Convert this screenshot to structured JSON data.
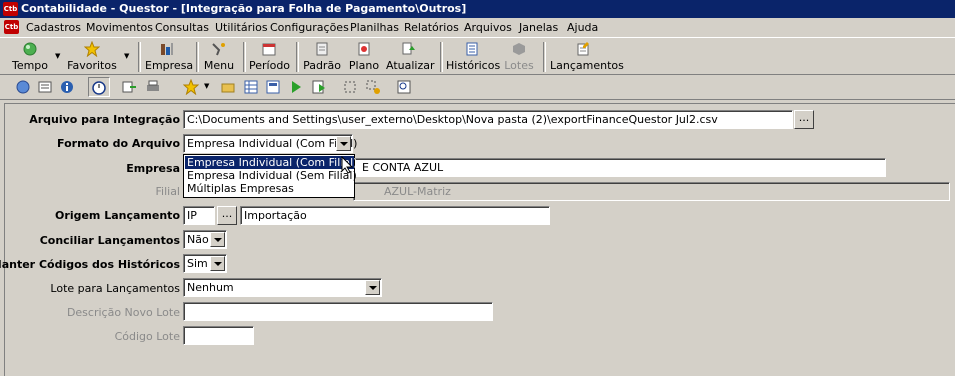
{
  "window": {
    "app_icon": "Ctb",
    "title": "Contabilidade - Questor - [Integração para Folha de Pagamento\\Outros]"
  },
  "menubar": {
    "items": [
      "Cadastros",
      "Movimentos",
      "Consultas",
      "Utilitários",
      "Configurações",
      "Planilhas",
      "Relatórios",
      "Arquivos",
      "Janelas",
      "Ajuda"
    ]
  },
  "toolbar": {
    "tempo": "Tempo",
    "favoritos": "Favoritos",
    "empresa": "Empresa",
    "menu": "Menu",
    "periodo": "Período",
    "padrao": "Padrão",
    "plano": "Plano",
    "atualizar": "Atualizar",
    "historicos": "Históricos",
    "lotes": "Lotes",
    "lancamentos": "Lançamentos"
  },
  "form": {
    "arquivo_label": "Arquivo para Integração",
    "arquivo_value": "C:\\Documents and Settings\\user_externo\\Desktop\\Nova pasta (2)\\exportFinanceQuestor Jul2.csv",
    "formato_label": "Formato do Arquivo",
    "formato_value": "Empresa Individual (Com Filial)",
    "formato_options": [
      "Empresa Individual (Com Filial)",
      "Empresa Individual (Sem Filial)",
      "Múltiplas Empresas"
    ],
    "empresa_label": "Empresa",
    "empresa_value": "E CONTA AZUL",
    "filial_label": "Filial",
    "filial_value": "AZUL-Matriz",
    "origem_label": "Origem Lançamento",
    "origem_code": "IP",
    "origem_desc": "Importação",
    "conciliar_label": "Conciliar Lançamentos",
    "conciliar_value": "Não",
    "manter_label": "Manter Códigos dos Históricos",
    "manter_value": "Sim",
    "lote_label": "Lote para Lançamentos",
    "lote_value": "Nenhum",
    "descricao_label": "Descrição Novo Lote",
    "descricao_value": "",
    "codigo_label": "Código Lote",
    "codigo_value": "",
    "browse": "..."
  }
}
